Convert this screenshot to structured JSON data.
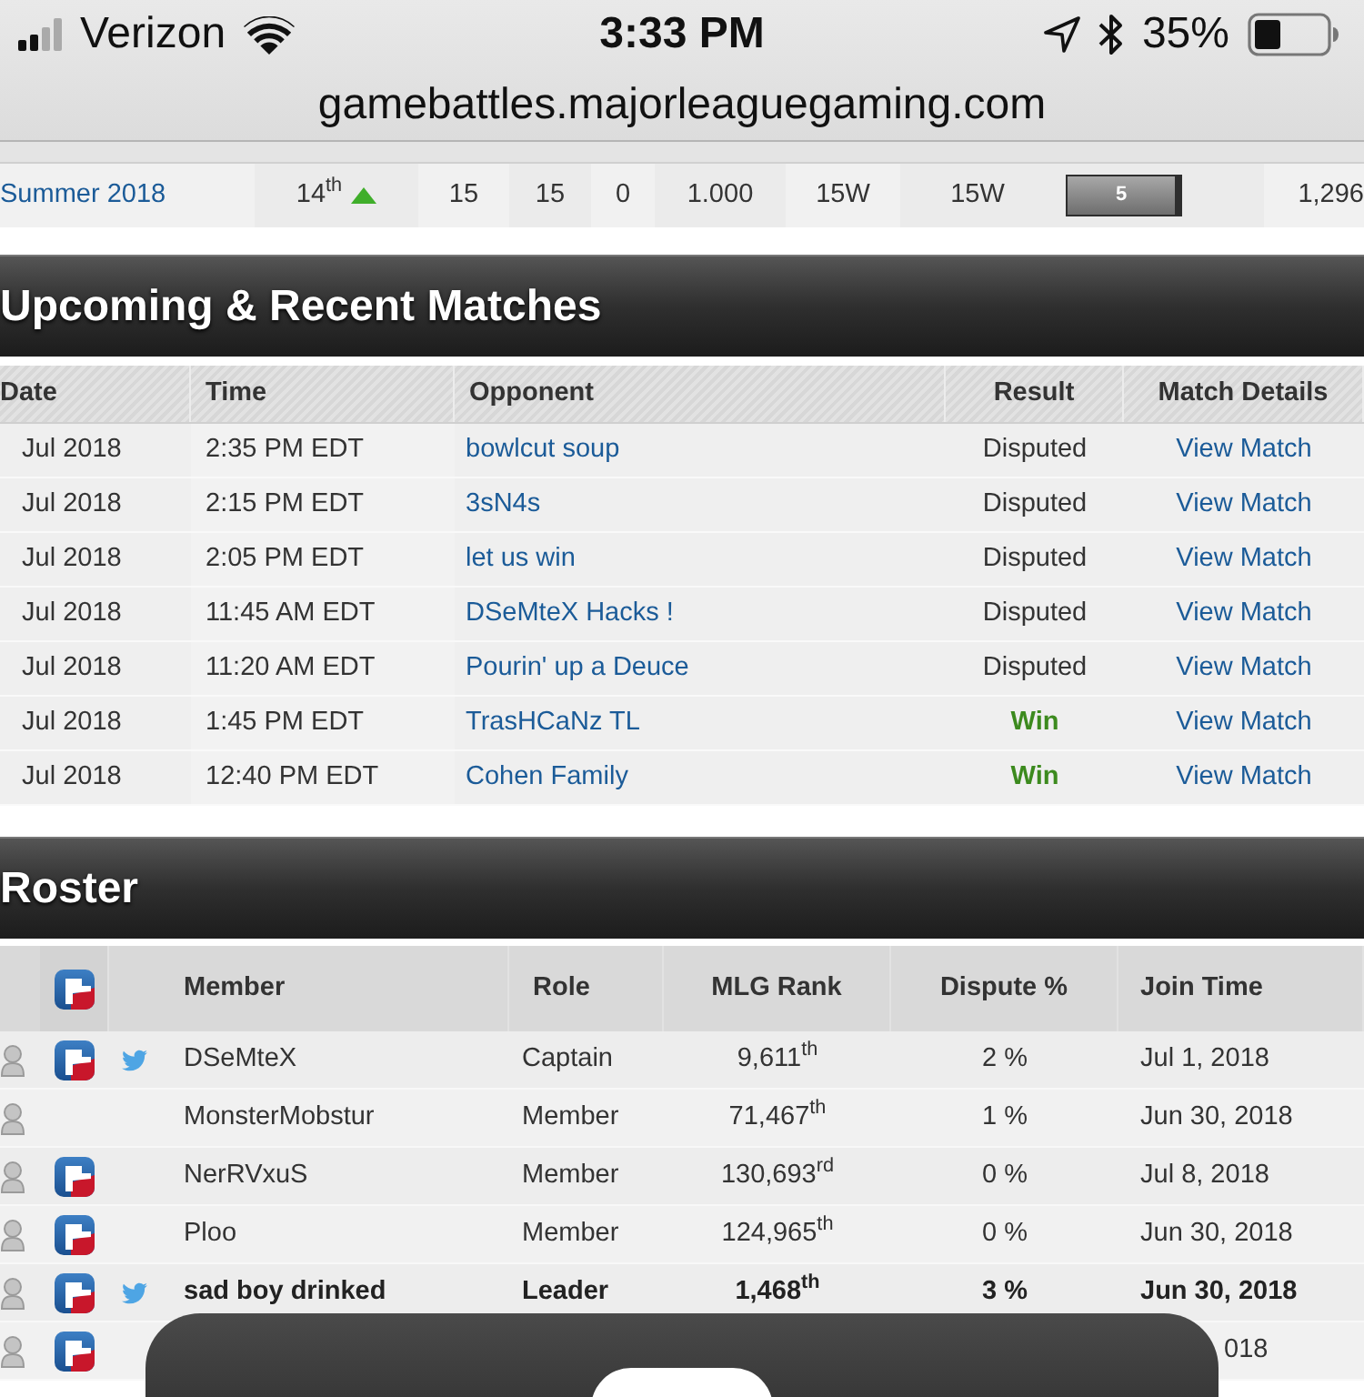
{
  "status_bar": {
    "carrier": "Verizon",
    "time": "3:33 PM",
    "battery": "35%"
  },
  "address_bar": {
    "url": "gamebattles.majorleaguegaming.com"
  },
  "season_row": {
    "season": "Summer 2018",
    "place": "14$^{th}$",
    "rising": true,
    "cells": [
      "15",
      "15",
      "0",
      "1.000",
      "15W",
      "15W"
    ],
    "level_badge": "5",
    "column_10": "1,296"
  },
  "matches": {
    "title": "Upcoming & Recent Matches",
    "columns": [
      "Date",
      "Time",
      "Opponent",
      "Result",
      "Match Details"
    ],
    "rows": [
      {
        "date": "Jul 2018",
        "time": "2:35 PM EDT",
        "opponent": "bowlcut soup",
        "result": "Disputed",
        "kind": "disputed",
        "details": "View Match"
      },
      {
        "date": "Jul 2018",
        "time": "2:15 PM EDT",
        "opponent": "3sN4s",
        "result": "Disputed",
        "kind": "disputed",
        "details": "View Match"
      },
      {
        "date": "Jul 2018",
        "time": "2:05 PM EDT",
        "opponent": "let us win",
        "result": "Disputed",
        "kind": "disputed",
        "details": "View Match"
      },
      {
        "date": "Jul 2018",
        "time": "11:45 AM EDT",
        "opponent": "DSeMteX Hacks !",
        "result": "Disputed",
        "kind": "disputed",
        "details": "View Match"
      },
      {
        "date": "Jul 2018",
        "time": "11:20 AM EDT",
        "opponent": "Pourin' up a Deuce",
        "result": "Disputed",
        "kind": "disputed",
        "details": "View Match"
      },
      {
        "date": "Jul 2018",
        "time": "1:45 PM EDT",
        "opponent": "TrasHCaNz TL",
        "result": "Win",
        "kind": "win",
        "details": "View Match"
      },
      {
        "date": "Jul 2018",
        "time": "12:40 PM EDT",
        "opponent": "Cohen Family",
        "result": "Win",
        "kind": "win",
        "details": "View Match"
      }
    ]
  },
  "roster": {
    "title": "Roster",
    "columns": [
      "Member",
      "Role",
      "MLG Rank",
      "Dispute %",
      "Join Time"
    ],
    "rows": [
      {
        "member": "DSeMteX",
        "role": "Captain",
        "rank": "9,611$^{th}$",
        "dispute": "2 %",
        "joined": "Jul 1, 2018",
        "mlg": true,
        "twitter": true,
        "highlighted": false,
        "covered": false
      },
      {
        "member": "MonsterMobstur",
        "role": "Member",
        "rank": "71,467$^{th}$",
        "dispute": "1 %",
        "joined": "Jun 30, 2018",
        "mlg": false,
        "twitter": false,
        "highlighted": false,
        "covered": false
      },
      {
        "member": "NerRVxuS",
        "role": "Member",
        "rank": "130,693$^{rd}$",
        "dispute": "0 %",
        "joined": "Jul 8, 2018",
        "mlg": true,
        "twitter": false,
        "highlighted": false,
        "covered": false
      },
      {
        "member": "Ploo",
        "role": "Member",
        "rank": "124,965$^{th}$",
        "dispute": "0 %",
        "joined": "Jun 30, 2018",
        "mlg": true,
        "twitter": false,
        "highlighted": false,
        "covered": false
      },
      {
        "member": "sad boy drinked",
        "role": "Leader",
        "rank": "1,468$^{th}$",
        "dispute": "3 %",
        "joined": "Jun 30, 2018",
        "mlg": true,
        "twitter": true,
        "highlighted": true,
        "covered": false
      },
      {
        "joined": "018",
        "mlg": true,
        "twitter": false,
        "highlighted": false,
        "covered": true
      }
    ]
  }
}
